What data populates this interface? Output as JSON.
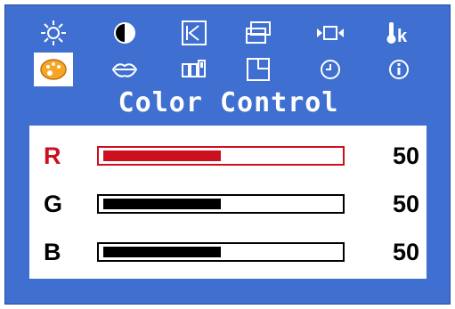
{
  "menu": {
    "title": "Color Control",
    "icons_row1": [
      "brightness-icon",
      "contrast-icon",
      "position-icon",
      "size-icon",
      "video-input-icon",
      "color-temperature-icon"
    ],
    "icons_row2": [
      "color-control-icon",
      "language-icon",
      "image-setup-icon",
      "display-mode-icon",
      "osd-timer-icon",
      "information-icon"
    ],
    "selected_icon": "color-control-icon"
  },
  "channels": [
    {
      "label": "R",
      "value": "50",
      "level": 0.5,
      "color": "#cc1020"
    },
    {
      "label": "G",
      "value": "50",
      "level": 0.5,
      "color": "#000000"
    },
    {
      "label": "B",
      "value": "50",
      "level": 0.5,
      "color": "#000000"
    }
  ],
  "colors": {
    "background": "#3f6fd0",
    "panel": "#ffffff",
    "accent": "#cc1020",
    "palette_icon": "#f5a623"
  }
}
